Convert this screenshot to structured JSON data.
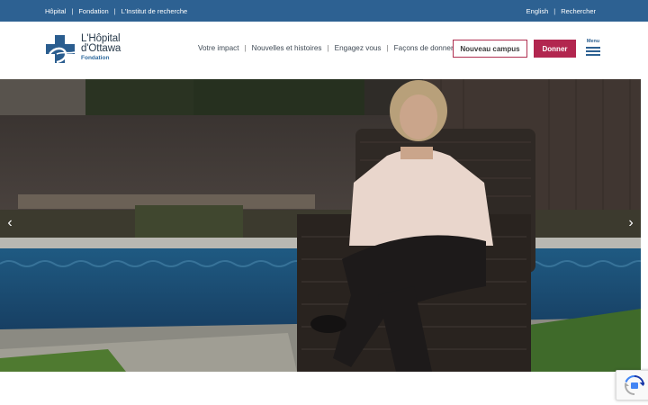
{
  "topbar": {
    "links_left": [
      "Hôpital",
      "Fondation",
      "L'Institut de recherche"
    ],
    "links_right": [
      "English",
      "Rechercher"
    ],
    "separator": "|"
  },
  "logo": {
    "name_line1": "L'Hôpital",
    "name_line2": "d'Ottawa",
    "sub": "Fondation",
    "icon": "hospital-cross-logo-icon"
  },
  "nav": {
    "items": [
      "Votre impact",
      "Nouvelles et histoires",
      "Engagez vous",
      "Façons de donner"
    ],
    "separator": "|"
  },
  "buttons": {
    "campus": "Nouveau campus",
    "donate": "Donner",
    "menu_label": "Menu"
  },
  "hero": {
    "prev_icon": "‹",
    "next_icon": "›"
  },
  "colors": {
    "topbar": "#2d6192",
    "brand_blue": "#2d6192",
    "donate": "#b2264f",
    "campus_border": "#b03051"
  }
}
